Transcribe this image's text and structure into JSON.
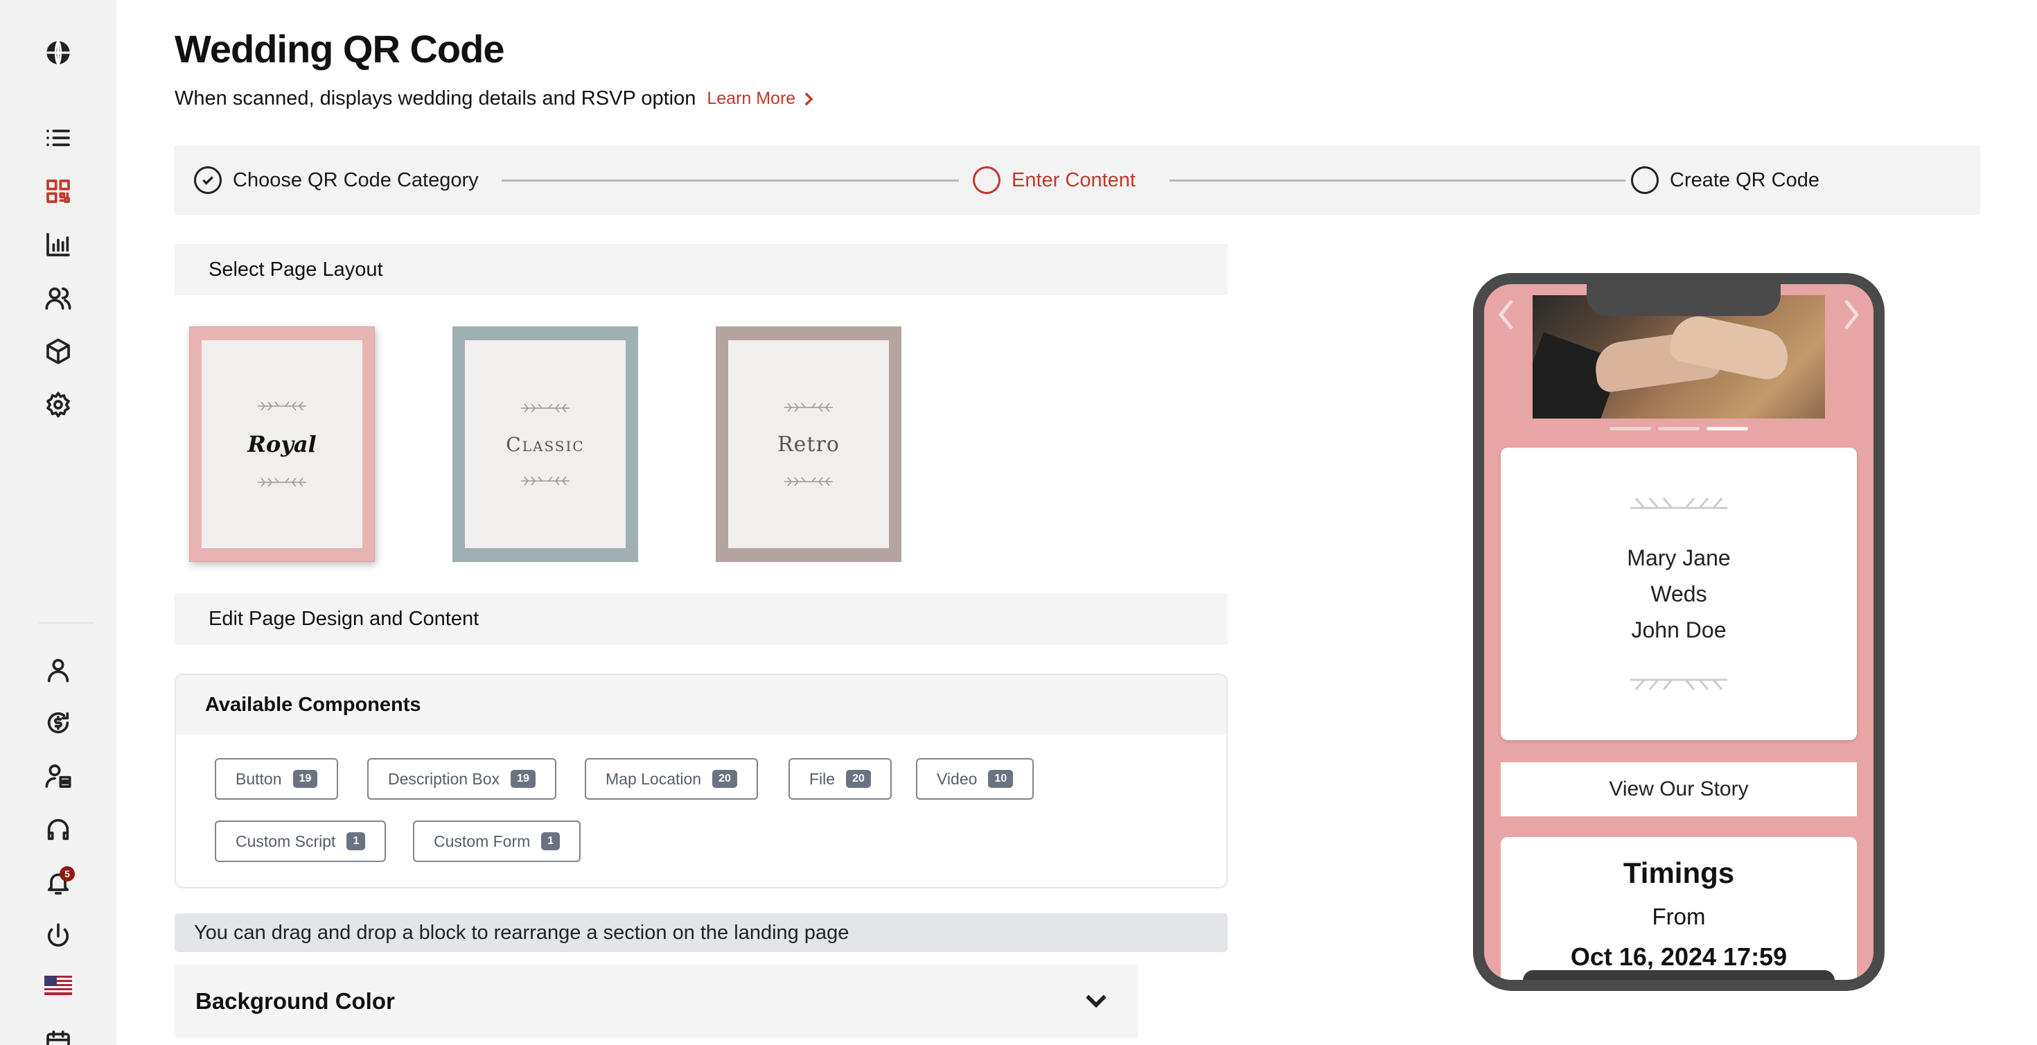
{
  "header": {
    "title": "Wedding QR Code",
    "subtitle": "When scanned, displays wedding details and RSVP option",
    "learn_more": "Learn More"
  },
  "stepper": {
    "steps": [
      {
        "label": "Choose QR Code Category",
        "state": "done"
      },
      {
        "label": "Enter Content",
        "state": "current"
      },
      {
        "label": "Create QR Code",
        "state": "pending"
      }
    ]
  },
  "sections": {
    "select_layout": "Select Page Layout",
    "edit_design": "Edit Page Design and Content"
  },
  "layouts": [
    {
      "name": "Royal",
      "selected": true,
      "color": "#e8b4b4"
    },
    {
      "name": "Classic",
      "selected": false,
      "color": "#9fb0b3"
    },
    {
      "name": "Retro",
      "selected": false,
      "color": "#b5a5a1"
    }
  ],
  "components": {
    "title": "Available Components",
    "items": [
      {
        "label": "Button",
        "count": "19"
      },
      {
        "label": "Description Box",
        "count": "19"
      },
      {
        "label": "Map Location",
        "count": "20"
      },
      {
        "label": "File",
        "count": "20"
      },
      {
        "label": "Video",
        "count": "10"
      },
      {
        "label": "Custom Script",
        "count": "1"
      },
      {
        "label": "Custom Form",
        "count": "1"
      }
    ]
  },
  "hint": "You can drag and drop a block to rearrange a section on the landing page",
  "background_color": {
    "label": "Background Color"
  },
  "sidebar": {
    "notification_count": "5",
    "icons": [
      "globe-icon",
      "list-icon",
      "qr-code-icon",
      "bar-chart-icon",
      "users-icon",
      "box-icon",
      "gear-icon",
      "user-icon",
      "billing-icon",
      "user-card-icon",
      "headset-icon",
      "bell-icon",
      "power-icon",
      "us-flag-icon",
      "calendar-icon"
    ]
  },
  "preview": {
    "line1": "Mary Jane",
    "line2": "Weds",
    "line3": "John Doe",
    "story_button": "View Our Story",
    "timings_title": "Timings",
    "from_label": "From",
    "from_date": "Oct 16, 2024 17:59"
  },
  "colors": {
    "accent": "#c0392b",
    "preview_bg": "#e8a5a5"
  }
}
